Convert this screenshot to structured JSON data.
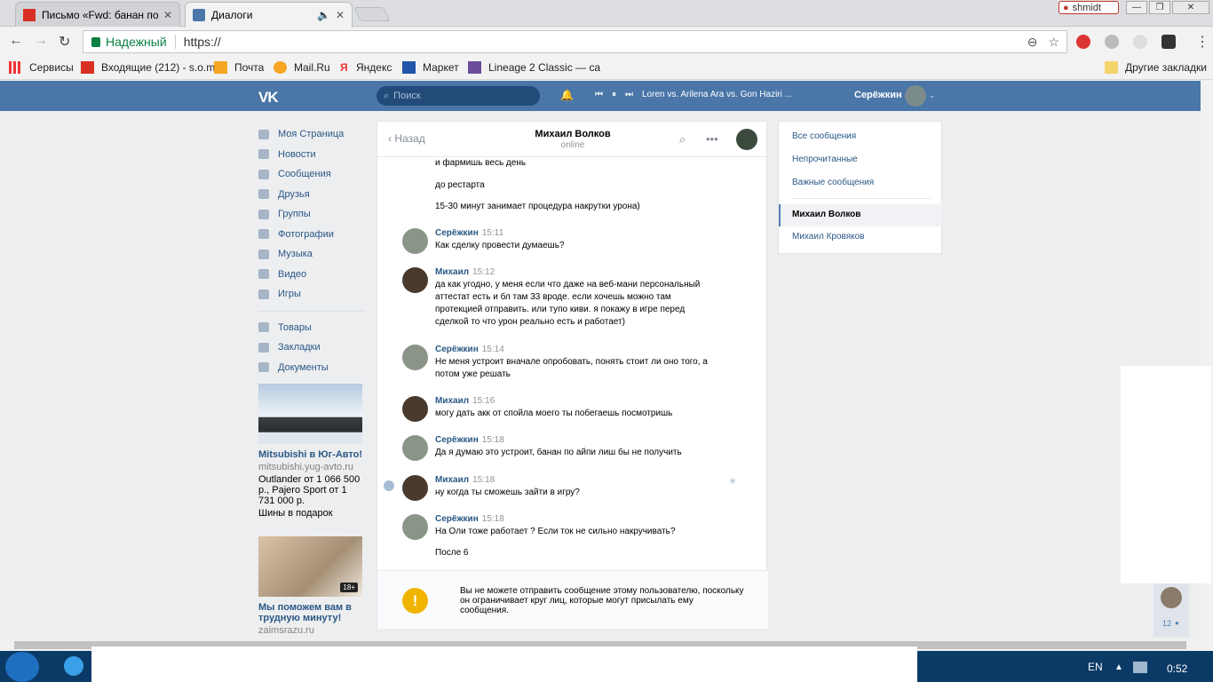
{
  "browser": {
    "tabs": [
      {
        "title": "Письмо «Fwd: банан по ж",
        "close": "✕"
      },
      {
        "title": "Диалоги",
        "close": "✕",
        "active": true
      }
    ],
    "profile_name": "shmidt",
    "security_label": "Надежный",
    "url": "https://",
    "bookmarks": [
      "Сервисы",
      "Входящие (212) - s.o.m",
      "Почта",
      "Mail.Ru",
      "Яндекс",
      "Маркет",
      "Lineage 2 Classic — ca"
    ],
    "other_bookmarks": "Другие закладки"
  },
  "vk": {
    "logo": "VK",
    "search_placeholder": "Поиск",
    "now_playing": "Loren vs. Arilena Ara vs. Gon Haziri ...",
    "user_name": "Серёжкин",
    "nav": [
      "Моя Страница",
      "Новости",
      "Сообщения",
      "Друзья",
      "Группы",
      "Фотографии",
      "Музыка",
      "Видео",
      "Игры"
    ],
    "nav2": [
      "Товары",
      "Закладки",
      "Документы"
    ],
    "ads": [
      {
        "title": "Mitsubishi в Юг-Авто!",
        "domain": "mitsubishi.yug-avto.ru",
        "text": "Outlander от 1 066 500 р., Pajero Sport от 1 731 000 р.",
        "text2": "Шины в подарок"
      },
      {
        "title": "Мы поможем вам в трудную минуту!",
        "domain": "zaimsrazu.ru",
        "badge": "18+"
      }
    ]
  },
  "chat": {
    "back": "Назад",
    "peer_name": "Михаил Волков",
    "peer_status": "online",
    "continued_lines": [
      "и фармишь весь день",
      "до рестарта",
      "15-30 минут занимает процедура накрутки урона)"
    ],
    "messages": [
      {
        "author": "Серёжкин",
        "time": "15:11",
        "text": "Как сделку провести думаешь?"
      },
      {
        "author": "Михаил",
        "time": "15:12",
        "text": "да как угодно, у меня если что даже на веб-мани персональный аттестат есть и бл там 33 вроде. если хочешь можно там протекцией отправить. или тупо киви. я покажу в игре перед сделкой то что урон реально есть и работает)"
      },
      {
        "author": "Серёжкин",
        "time": "15:14",
        "text": "Не меня устроит вначале опробовать, понять стоит ли оно того, а потом уже решать"
      },
      {
        "author": "Михаил",
        "time": "15:16",
        "text": "могу дать акк от спойла моего ты побегаешь посмотришь"
      },
      {
        "author": "Серёжкин",
        "time": "15:18",
        "text": "Да я думаю это устроит, банан по айпи лиш бы не получить"
      },
      {
        "author": "Михаил",
        "time": "15:18",
        "text": "ну когда ты сможешь зайти в игру?"
      },
      {
        "author": "Серёжкин",
        "time": "15:18",
        "text": "На Оли тоже работает ? Если ток не сильно накручивать?"
      }
    ],
    "last_line": "После 6",
    "notice": "Вы не можете отправить сообщение этому пользователю, поскольку он ограничивает круг лиц, которые могут присылать ему сообщения."
  },
  "filters": {
    "items": [
      "Все сообщения",
      "Непрочитанные",
      "Важные сообщения"
    ],
    "dialogs": [
      "Михаил Волков",
      "Михаил Кровяков"
    ],
    "widget_count": "12"
  },
  "taskbar": {
    "lang": "EN",
    "time": "0:52"
  }
}
